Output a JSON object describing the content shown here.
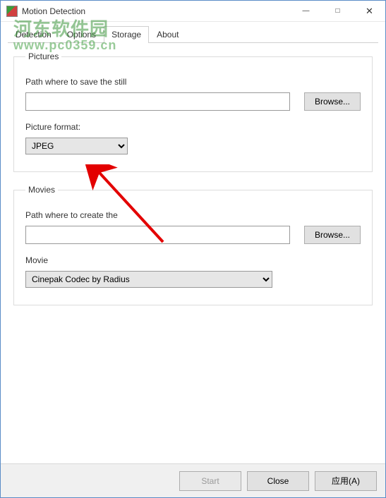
{
  "window": {
    "title": "Motion Detection"
  },
  "tabs": {
    "detection": "Detection",
    "options": "Options",
    "storage": "Storage",
    "about": "About"
  },
  "pictures": {
    "legend": "Pictures",
    "path_label": "Path where to save the still",
    "path_value": "",
    "browse_label": "Browse...",
    "format_label": "Picture format:",
    "format_value": "JPEG"
  },
  "movies": {
    "legend": "Movies",
    "path_label": "Path where to create the",
    "path_value": "",
    "browse_label": "Browse...",
    "codec_label": "Movie",
    "codec_value": "Cinepak Codec by Radius"
  },
  "footer": {
    "start": "Start",
    "close": "Close",
    "apply": "应用(A)"
  },
  "watermark": {
    "line1": "河东软件园",
    "line2": "www.pc0359.cn"
  }
}
